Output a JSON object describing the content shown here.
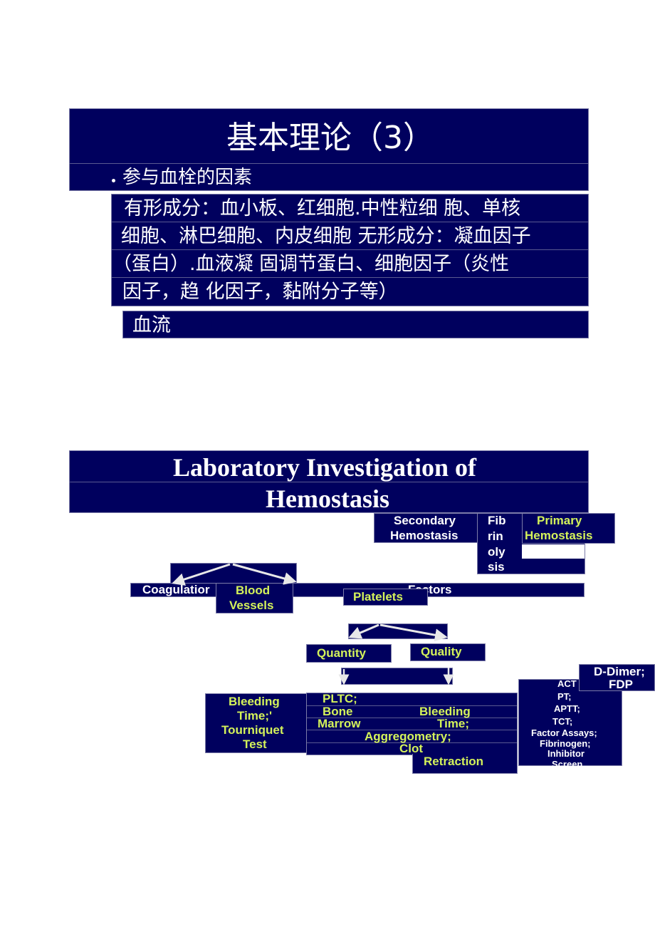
{
  "slide1": {
    "title": "基本理论（3）",
    "bullet": "参与血栓的因素",
    "body_lines": [
      "有形成分：血小板、红细胞.中性粒细 胞、单核",
      "细胞、淋巴细胞、内皮细胞 无形成分：凝血因子",
      "（蛋白）.血液凝 固调节蛋白、细胞因子（炎性",
      "因子，趋 化因子，黏附分子等）"
    ],
    "last_item": "血流"
  },
  "slide2": {
    "title_line1": "Laboratory Investigation of",
    "title_line2": "Hemostasis",
    "secondary": [
      "Secondary",
      "Hemostasis"
    ],
    "fibrinolysis": [
      "Fib",
      "rin",
      "oly",
      "sis"
    ],
    "primary": [
      "Primary",
      "Hemostasis"
    ],
    "coagulation": "Coagulatior",
    "factors": "Factors",
    "blood_vessels": [
      "Blood",
      "Vessels"
    ],
    "platelets": "Platelets",
    "quantity": "Quantity",
    "quality": "Quality",
    "vessel_tests": [
      "Bleeding",
      "Time;'",
      "Tourniquet",
      "Test"
    ],
    "platelet_tests": {
      "pltc": "PLTC;",
      "bone": "Bone",
      "marrow": "Marrow",
      "bleeding": "Bleeding",
      "time": "Time;",
      "aggregometry": "Aggregometry;",
      "clot": "Clot",
      "retraction": "Retraction"
    },
    "fibrinolysis_tests": [
      "D-Dimer;",
      "FDP"
    ],
    "coag_tests": [
      "ACT",
      "PT;",
      "APTT;",
      "TCT;",
      "Factor Assays;",
      "Fibrinogen;",
      "Inhibitor",
      "Screen"
    ]
  },
  "colors": {
    "box_bg": "#00005e",
    "text_white": "#ffffff",
    "text_yellow": "#d4f25a"
  }
}
